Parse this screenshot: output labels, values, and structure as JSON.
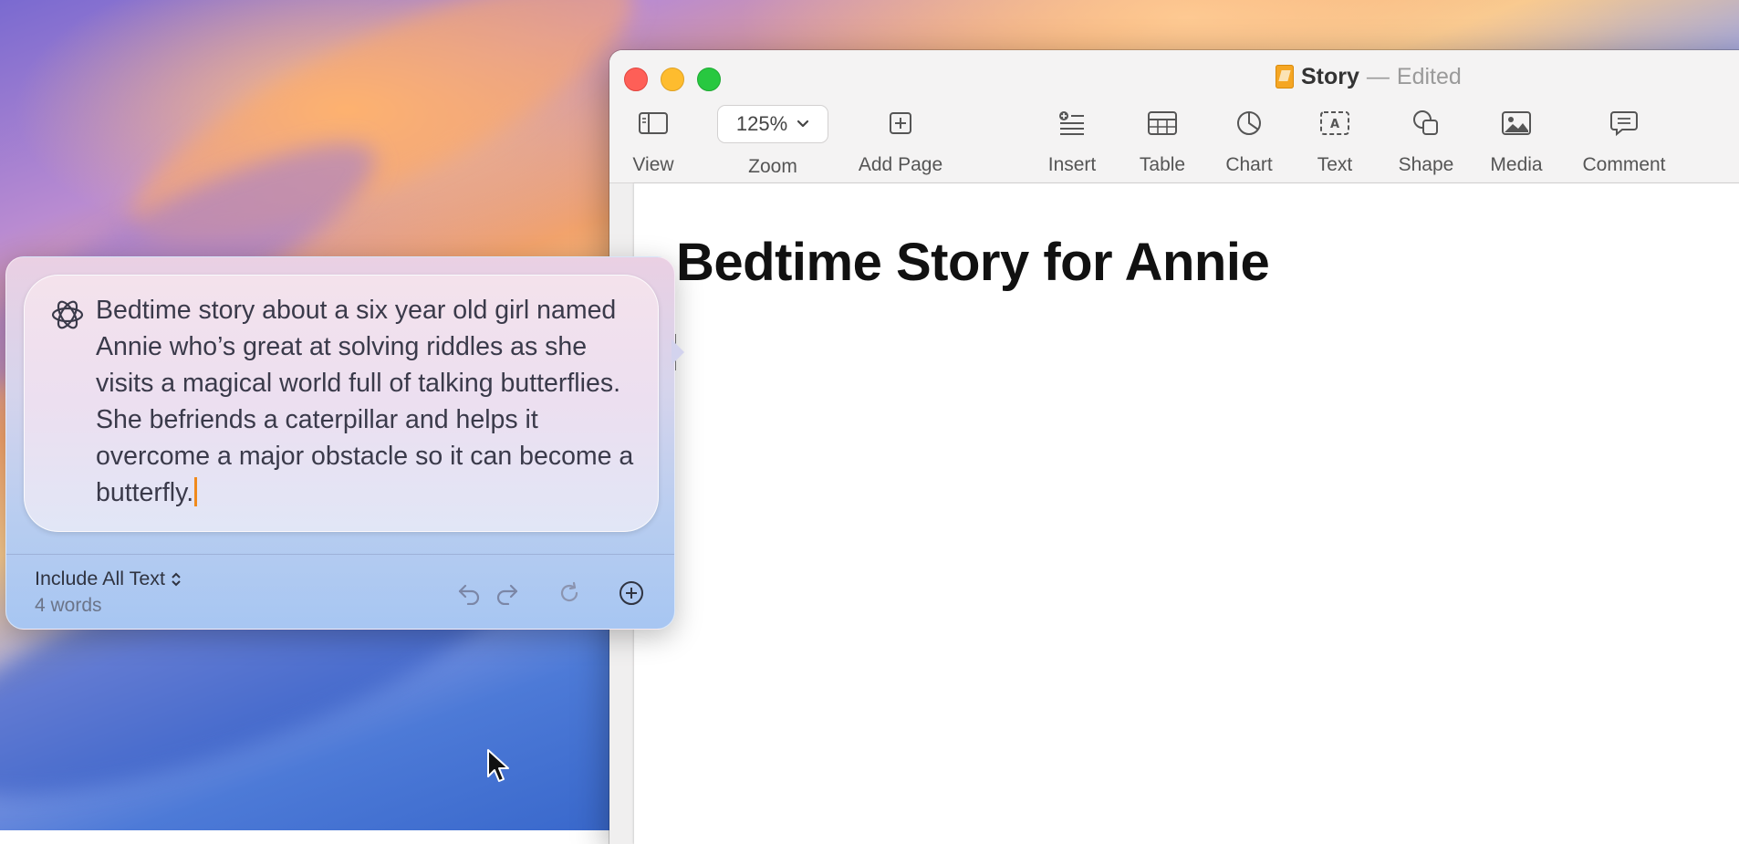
{
  "window": {
    "doc_name": "Story",
    "separator": "—",
    "doc_status": "Edited"
  },
  "toolbar": {
    "view_label": "View",
    "zoom_value": "125%",
    "zoom_label": "Zoom",
    "add_page_label": "Add Page",
    "insert_label": "Insert",
    "table_label": "Table",
    "chart_label": "Chart",
    "text_label": "Text",
    "shape_label": "Shape",
    "media_label": "Media",
    "comment_label": "Comment"
  },
  "document": {
    "title": "Bedtime Story for Annie"
  },
  "chatgpt_popover": {
    "prompt": "Bedtime story about a six year old girl named Annie who’s great at solving riddles as she visits a magical world full of talking butterflies. She befriends a caterpillar and helps it overcome a major obstacle so it can become a butterfly.",
    "include_label": "Include All Text",
    "word_count": "4 words"
  },
  "colors": {
    "accent_caret": "#f08a1c",
    "close": "#fe5f57",
    "minimize": "#febc2e",
    "maximize": "#28c840"
  }
}
